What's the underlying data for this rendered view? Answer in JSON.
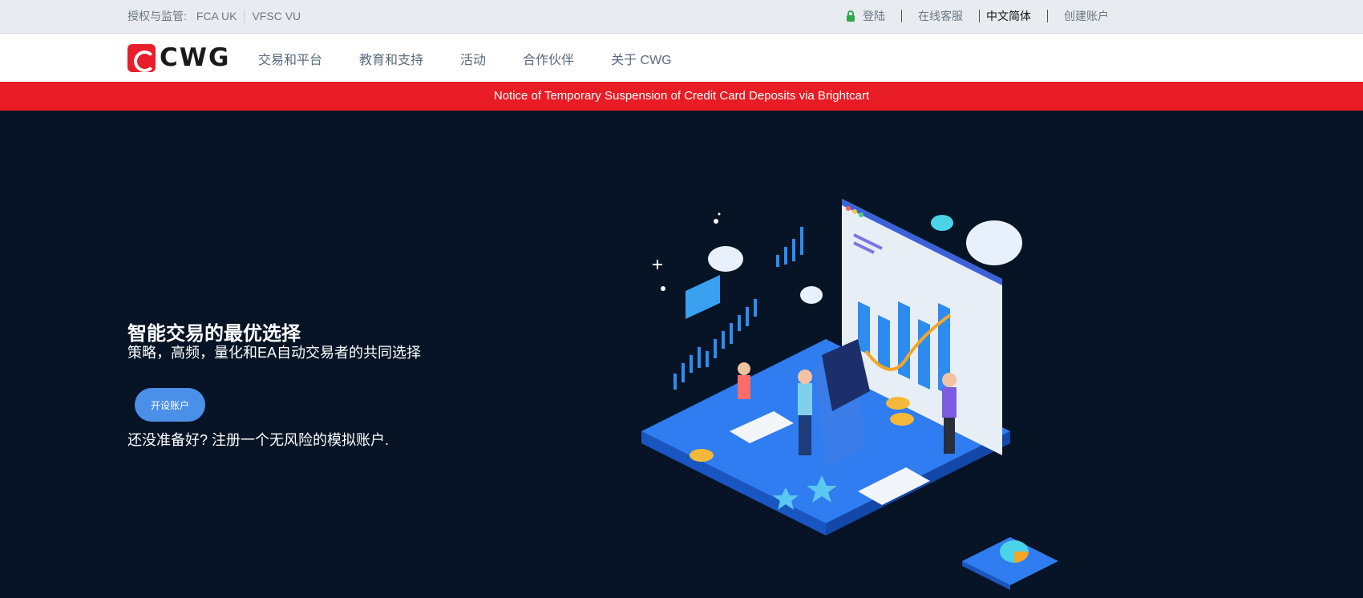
{
  "topbar": {
    "regulation_label": "授权与监管:",
    "regulators": [
      "FCA UK",
      "VFSC VU"
    ],
    "login": "登陆",
    "support": "在线客服",
    "language": "中文简体",
    "create_account": "创建账户"
  },
  "logo": {
    "text": "CWG",
    "brand_color": "#e81f2a"
  },
  "nav": {
    "items": [
      "交易和平台",
      "教育和支持",
      "活动",
      "合作伙伴",
      "关于 CWG"
    ]
  },
  "notice": {
    "text": "Notice of Temporary Suspension of Credit Card Deposits via Brightcart",
    "color": "#e81c24"
  },
  "hero": {
    "title": "智能交易的最优选择",
    "subtitle": "策略，高频，量化和EA自动交易者的共同选择",
    "cta_label": "开设账户",
    "demo_text": "还没准备好? 注册一个无风险的模拟账户.",
    "background": "#061426",
    "accent": "#4a8fe8"
  },
  "icons": {
    "lock": "lock-icon",
    "illustration": "trading-platform-isometric-illustration"
  }
}
